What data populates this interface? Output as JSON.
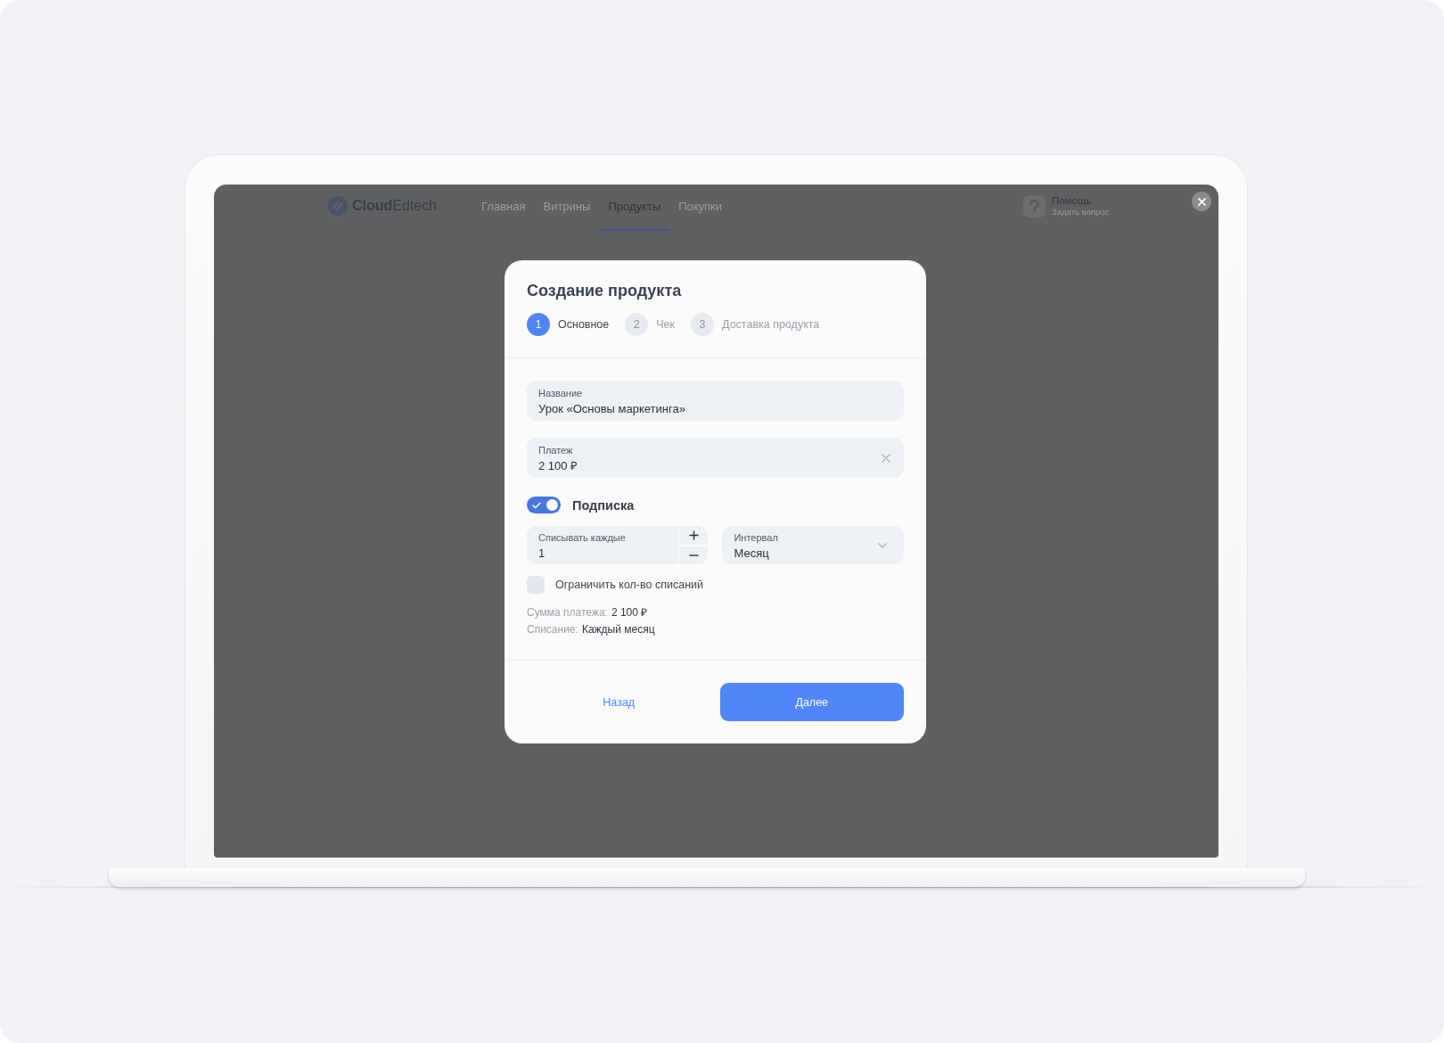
{
  "app_header": {
    "logo": "**Cloud**Edtech",
    "nav": [
      {
        "label": "Главная",
        "selected": false
      },
      {
        "label": "Витрины",
        "selected": false
      },
      {
        "label": "Продукты",
        "selected": true
      },
      {
        "label": "Покупки",
        "selected": false
      }
    ],
    "help": {
      "title": "Помощь",
      "subtitle": "Задать вопрос"
    }
  },
  "modal": {
    "title": "Создание продукта",
    "steps": [
      {
        "number": "1",
        "label": "Основное",
        "selected": true
      },
      {
        "number": "2",
        "label": "Чек",
        "selected": false
      },
      {
        "number": "3",
        "label": "Доставка продукта",
        "selected": false
      }
    ],
    "fields": [
      {
        "label": "Название",
        "value": "Урок «Основы маркетинга»",
        "clearable": false
      },
      {
        "label": "Платеж",
        "value": "2 100 ₽",
        "clearable": true
      }
    ],
    "subscription": {
      "label": "Подписка",
      "on": true
    },
    "charge_every": {
      "label": "Списывать каждые",
      "value": "1"
    },
    "interval": {
      "label": "Интервал",
      "value": "Месяц"
    },
    "limit": {
      "label": "Ограничить кол-во списаний",
      "checked": false
    },
    "summary": [
      {
        "label": "Сумма платежа:",
        "value": "2 100 ₽"
      },
      {
        "label": "Списание:",
        "value": "Каждый месяц"
      }
    ],
    "back_button": "Назад",
    "next_button": "Далее"
  }
}
